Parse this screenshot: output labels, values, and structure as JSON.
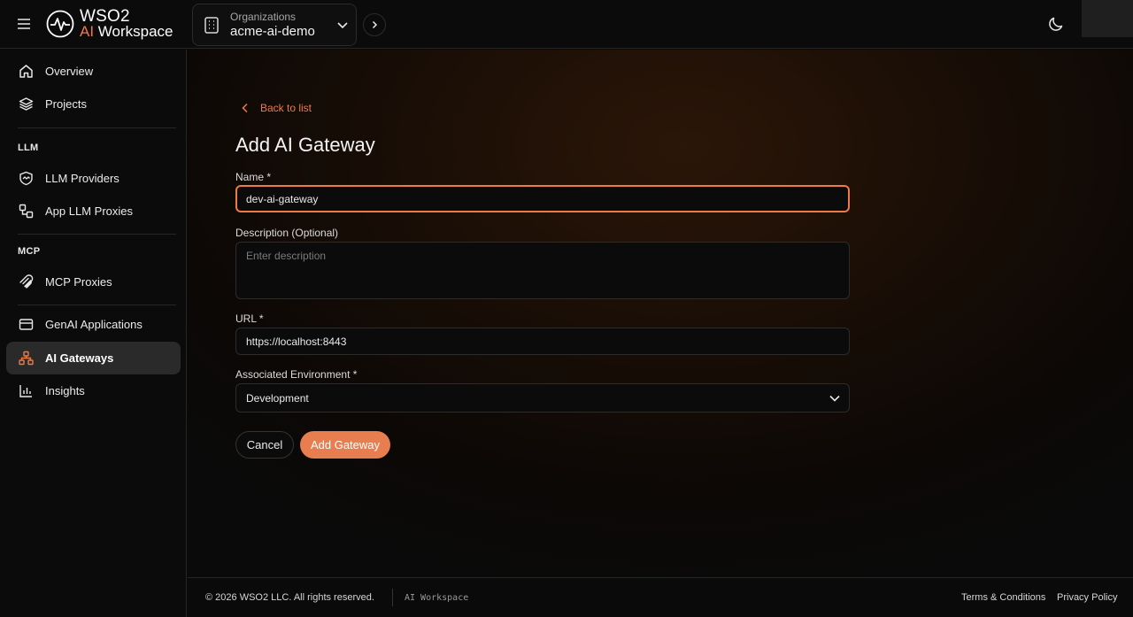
{
  "header": {
    "logo_line1": "WSO2",
    "logo_ai": "AI",
    "logo_workspace": "Workspace",
    "org_label": "Organizations",
    "org_value": "acme-ai-demo"
  },
  "sidebar": {
    "items_top": [
      {
        "label": "Overview",
        "icon": "home-icon"
      },
      {
        "label": "Projects",
        "icon": "layers-icon"
      }
    ],
    "llm_heading": "LLM",
    "items_llm": [
      {
        "label": "LLM Providers",
        "icon": "shield-network-icon"
      },
      {
        "label": "App LLM Proxies",
        "icon": "proxy-icon"
      }
    ],
    "mcp_heading": "MCP",
    "items_mcp": [
      {
        "label": "MCP Proxies",
        "icon": "mcp-icon"
      }
    ],
    "items_bottom": [
      {
        "label": "GenAI Applications",
        "icon": "card-icon"
      },
      {
        "label": "AI Gateways",
        "icon": "network-icon",
        "active": true
      },
      {
        "label": "Insights",
        "icon": "bar-chart-icon"
      }
    ]
  },
  "main": {
    "back_label": "Back to list",
    "title": "Add AI Gateway",
    "name_label": "Name",
    "name_value": "dev-ai-gateway",
    "description_label": "Description (Optional)",
    "description_placeholder": "Enter description",
    "url_label": "URL",
    "url_value": "https://localhost:8443",
    "env_label": "Associated Environment",
    "env_value": "Development",
    "required_mark": "*",
    "cancel_label": "Cancel",
    "add_label": "Add Gateway"
  },
  "footer": {
    "copyright": "© 2026 WSO2 LLC. All rights reserved.",
    "brand": "AI Workspace",
    "terms": "Terms & Conditions",
    "privacy": "Privacy Policy"
  },
  "colors": {
    "accent": "#f07a45",
    "primary_button": "#e87e4f",
    "background": "#0a0a0a"
  }
}
